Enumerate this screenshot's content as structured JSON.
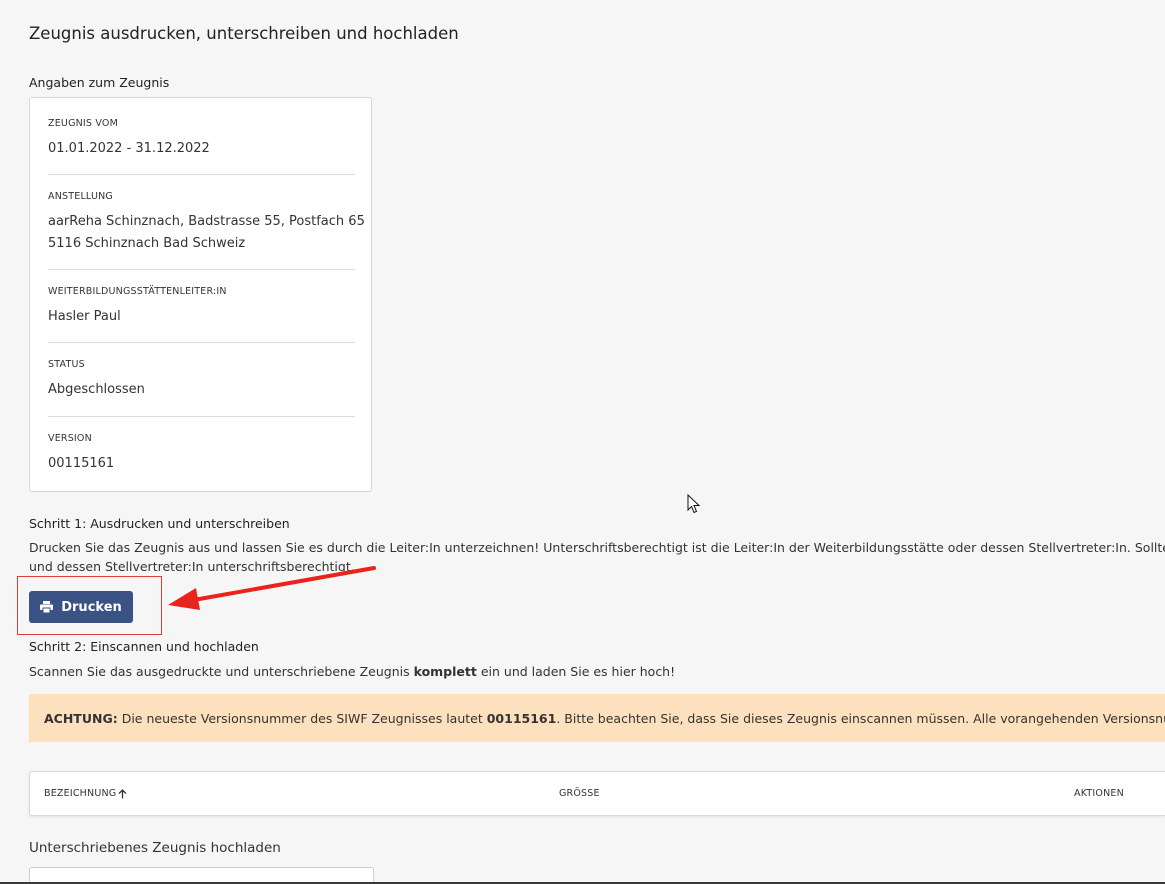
{
  "page": {
    "title": "Zeugnis ausdrucken, unterschreiben und hochladen"
  },
  "details": {
    "section_label": "Angaben zum Zeugnis",
    "fields": [
      {
        "label": "ZEUGNIS VOM",
        "value": "01.01.2022 - 31.12.2022"
      },
      {
        "label": "ANSTELLUNG",
        "value_line1": "aarReha Schinznach, Badstrasse 55, Postfach 65",
        "value_line2": "5116 Schinznach Bad Schweiz"
      },
      {
        "label": "WEITERBILDUNGSSTÄTTENLEITER:IN",
        "value": "Hasler Paul"
      },
      {
        "label": "STATUS",
        "value": "Abgeschlossen"
      },
      {
        "label": "VERSION",
        "value": "00115161"
      }
    ]
  },
  "step1": {
    "heading": "Schritt 1: Ausdrucken und unterschreiben",
    "text_line1": "Drucken Sie das Zeugnis aus und lassen Sie es durch die Leiter:In unterzeichnen! Unterschriftsberechtigt ist die Leiter:In der Weiterbildungsstätte oder dessen Stellvertreter:In. Sollte es während Ihrer Tä",
    "text_line2": "und dessen Stellvertreter:In unterschriftsberechtigt.",
    "print_button": "Drucken"
  },
  "step2": {
    "heading": "Schritt 2: Einscannen und hochladen",
    "text_before": "Scannen Sie das ausgedruckte und unterschriebene Zeugnis ",
    "text_bold": "komplett",
    "text_after": " ein und laden Sie es hier hoch!"
  },
  "alert": {
    "label": "ACHTUNG:",
    "text_before": " Die neueste Versionsnummer des SIWF Zeugnisses lautet ",
    "version": "00115161",
    "text_after": ". Bitte beachten Sie, dass Sie dieses Zeugnis einscannen müssen. Alle vorangehenden Versionsnummern für diese Weit"
  },
  "table": {
    "columns": [
      "BEZEICHNUNG",
      "GRÖSSE",
      "AKTIONEN"
    ]
  },
  "upload": {
    "label": "Unterschriebenes Zeugnis hochladen"
  },
  "colors": {
    "primary": "#3b5284",
    "alert_bg": "#fde0bd",
    "annotation": "#e0403a",
    "background": "#f6f6f6"
  },
  "icons": {
    "print": "printer-icon",
    "sort": "arrow-up-icon",
    "cursor": "mouse-cursor-icon"
  }
}
